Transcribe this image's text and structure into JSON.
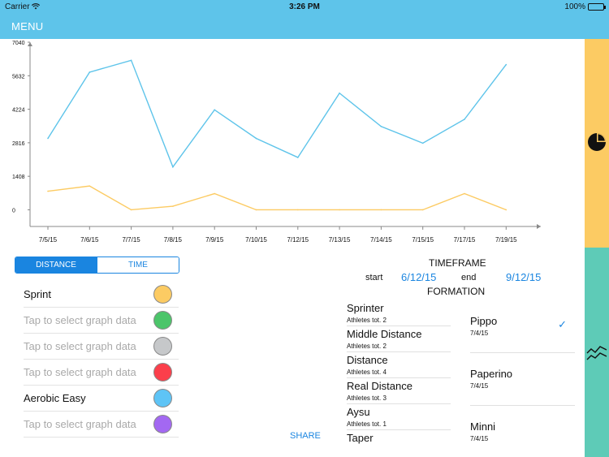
{
  "status_bar": {
    "carrier": "Carrier",
    "time": "3:26 PM",
    "battery": "100%"
  },
  "nav": {
    "menu_label": "MENU"
  },
  "chart_data": {
    "type": "line",
    "categories": [
      "7/5/15",
      "7/6/15",
      "7/7/15",
      "7/8/15",
      "7/9/15",
      "7/10/15",
      "7/12/15",
      "7/13/15",
      "7/14/15",
      "7/15/15",
      "7/17/15",
      "7/19/15"
    ],
    "y_ticks": [
      "7040",
      "5632",
      "4224",
      "2816",
      "1408",
      "0"
    ],
    "ylim": [
      -700,
      7040
    ],
    "grid": false,
    "series": [
      {
        "color": "#5ec4ea",
        "values": [
          3000,
          5780,
          6280,
          1800,
          4200,
          3000,
          2200,
          4900,
          3500,
          2800,
          3800,
          6100
        ]
      },
      {
        "color": "#fccb63",
        "values": [
          780,
          1000,
          0,
          150,
          680,
          0,
          0,
          0,
          0,
          0,
          680,
          0
        ]
      }
    ]
  },
  "controls": {
    "distance_label": "DISTANCE",
    "time_label": "TIME",
    "share_label": "SHARE"
  },
  "series_selector": [
    {
      "label": "Sprint",
      "set": true,
      "color": "#fccb63"
    },
    {
      "label": "Tap to select graph data",
      "set": false,
      "color": "#4cc56a"
    },
    {
      "label": "Tap to select graph data",
      "set": false,
      "color": "#c6c8ca"
    },
    {
      "label": "Tap to select graph data",
      "set": false,
      "color": "#fb3f4b"
    },
    {
      "label": "Aerobic Easy",
      "set": true,
      "color": "#5ec4f6"
    },
    {
      "label": "Tap to select graph data",
      "set": false,
      "color": "#a368f2"
    }
  ],
  "timeframe": {
    "title": "TIMEFRAME",
    "start_label": "start",
    "start_value": "6/12/15",
    "end_label": "end",
    "end_value": "9/12/15"
  },
  "formation": {
    "title": "FORMATION",
    "items": [
      {
        "name": "Sprinter",
        "count": "Athletes tot. 2"
      },
      {
        "name": "Middle Distance",
        "count": "Athletes tot. 2"
      },
      {
        "name": "Distance",
        "count": "Athletes tot. 4"
      },
      {
        "name": "Real Distance",
        "count": "Athletes tot. 3"
      },
      {
        "name": "Aysu",
        "count": "Athletes tot. 1"
      },
      {
        "name": "Taper",
        "count": ""
      }
    ]
  },
  "athletes": [
    {
      "name": "Pippo",
      "date": "7/4/15",
      "checked": true
    },
    {
      "name": "Paperino",
      "date": "7/4/15",
      "checked": false
    },
    {
      "name": "Minni",
      "date": "7/4/15",
      "checked": false
    }
  ],
  "icons": {
    "pie": "pie-chart-icon",
    "line": "line-chart-icon",
    "check": "checkmark-icon"
  }
}
